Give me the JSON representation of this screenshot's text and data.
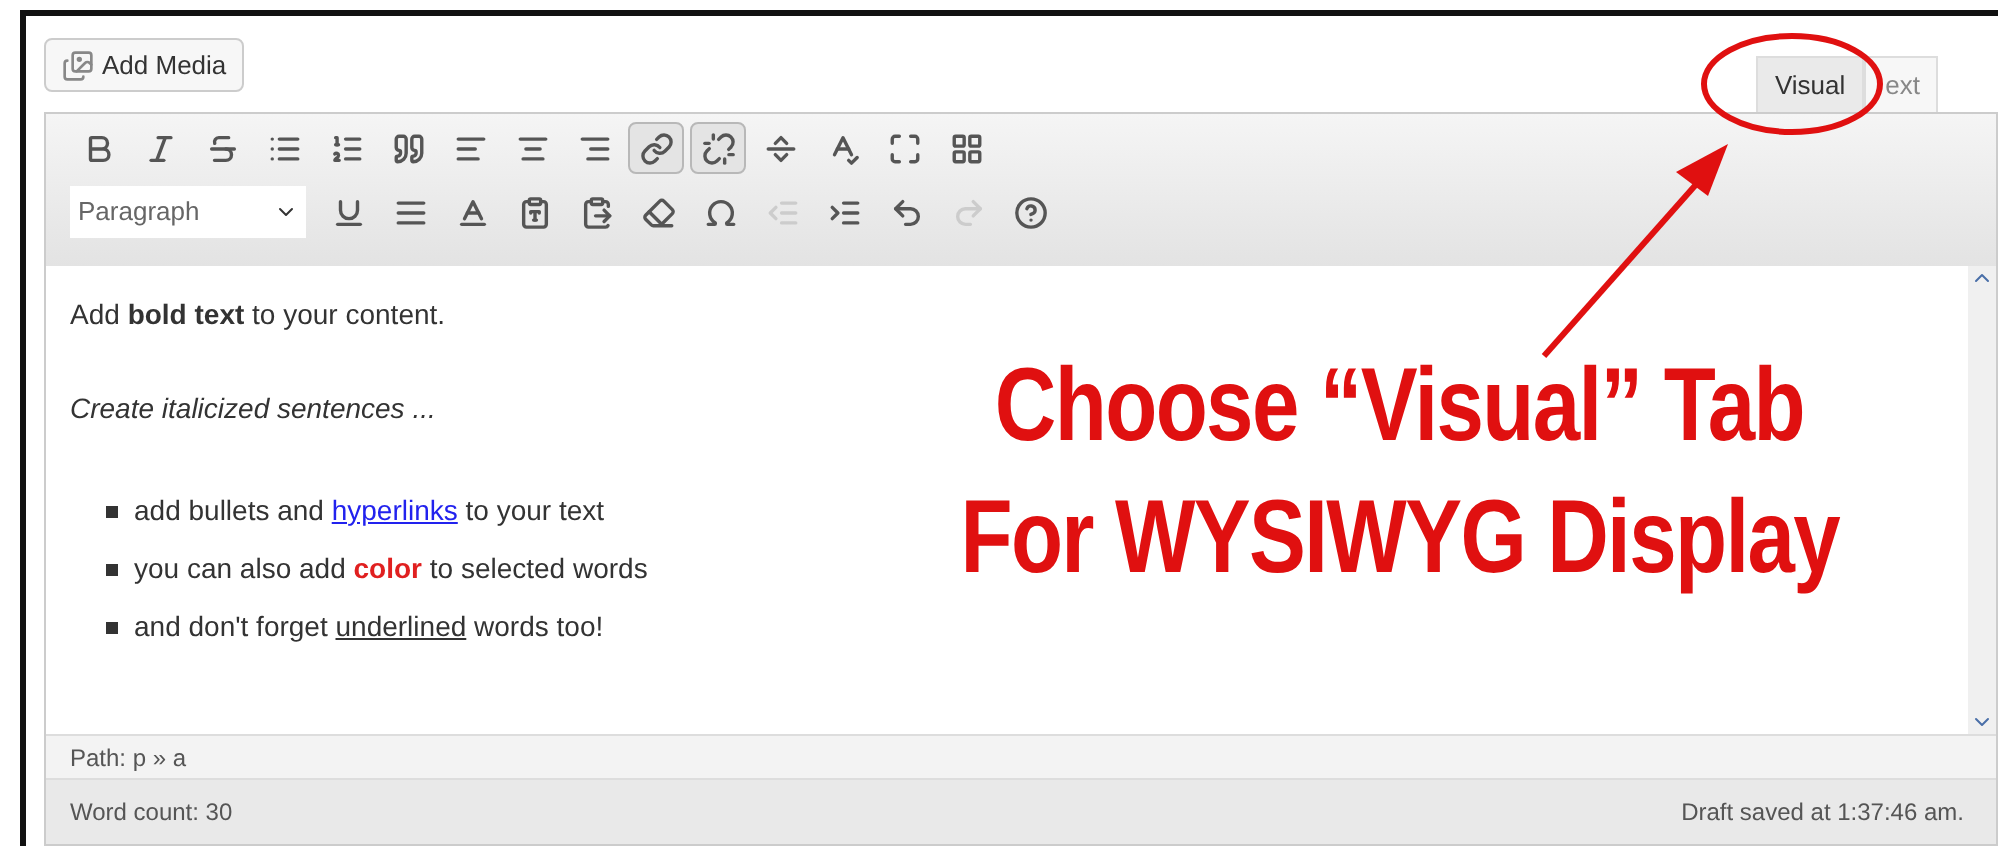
{
  "add_media_button": {
    "label": "Add Media"
  },
  "tabs": [
    {
      "label": "Visual",
      "selected": true
    },
    {
      "label": "ext",
      "selected": false
    }
  ],
  "toolbar": {
    "rows": [
      [
        {
          "pressed": false,
          "disabled": false
        },
        {
          "pressed": false,
          "disabled": false
        },
        {
          "pressed": false,
          "disabled": false
        },
        {
          "pressed": false,
          "disabled": false
        },
        {
          "pressed": false,
          "disabled": false
        },
        {
          "pressed": false,
          "disabled": false
        },
        {
          "pressed": false,
          "disabled": false
        },
        {
          "pressed": false,
          "disabled": false
        },
        {
          "pressed": false,
          "disabled": false
        },
        {
          "pressed": true,
          "disabled": false
        },
        {
          "pressed": true,
          "disabled": false
        },
        {
          "pressed": false,
          "disabled": false
        },
        {
          "pressed": false,
          "disabled": false
        },
        {
          "pressed": false,
          "disabled": false
        },
        {
          "pressed": false,
          "disabled": false
        }
      ],
      [
        {
          "pressed": false,
          "disabled": false
        },
        {
          "pressed": false,
          "disabled": false
        },
        {
          "pressed": false,
          "disabled": false
        },
        {
          "pressed": false,
          "disabled": false
        },
        {
          "pressed": false,
          "disabled": false
        },
        {
          "pressed": false,
          "disabled": false
        },
        {
          "pressed": false,
          "disabled": false
        },
        {
          "pressed": false,
          "disabled": true
        },
        {
          "pressed": false,
          "disabled": false
        },
        {
          "pressed": false,
          "disabled": false
        },
        {
          "pressed": false,
          "disabled": true
        },
        {
          "pressed": false,
          "disabled": false
        }
      ]
    ],
    "format_select": {
      "value": "Paragraph"
    }
  },
  "content": [
    {
      "kind": "paragraph",
      "text": "Add **bold text** to your content."
    },
    {
      "kind": "italic",
      "text": "Create italicized sentences ..."
    },
    {
      "kind": "bullet",
      "segments": [
        {
          "kind": "plain",
          "text": "add bullets and "
        },
        {
          "kind": "link",
          "text": "hyperlinks"
        },
        {
          "kind": "plain",
          "text": " to your text"
        }
      ]
    },
    {
      "kind": "bullet",
      "segments": [
        {
          "kind": "plain",
          "text": "you can also add "
        },
        {
          "kind": "color",
          "text": "color",
          "color": "#e02020"
        },
        {
          "kind": "plain",
          "text": " to selected words"
        }
      ]
    },
    {
      "kind": "bullet",
      "segments": [
        {
          "kind": "plain",
          "text": "and don't forget "
        },
        {
          "kind": "underline",
          "text": "underlined"
        },
        {
          "kind": "plain",
          "text": " words too!"
        }
      ]
    }
  ],
  "path_bar": {
    "text": "Path: p » a"
  },
  "status_bar": {
    "word_count": "Word count: 30",
    "draft_status": "Draft saved at 1:37:46 am."
  },
  "annotation": {
    "lines": [
      "Choose “Visual” Tab",
      "For WYSIWYG Display"
    ]
  }
}
